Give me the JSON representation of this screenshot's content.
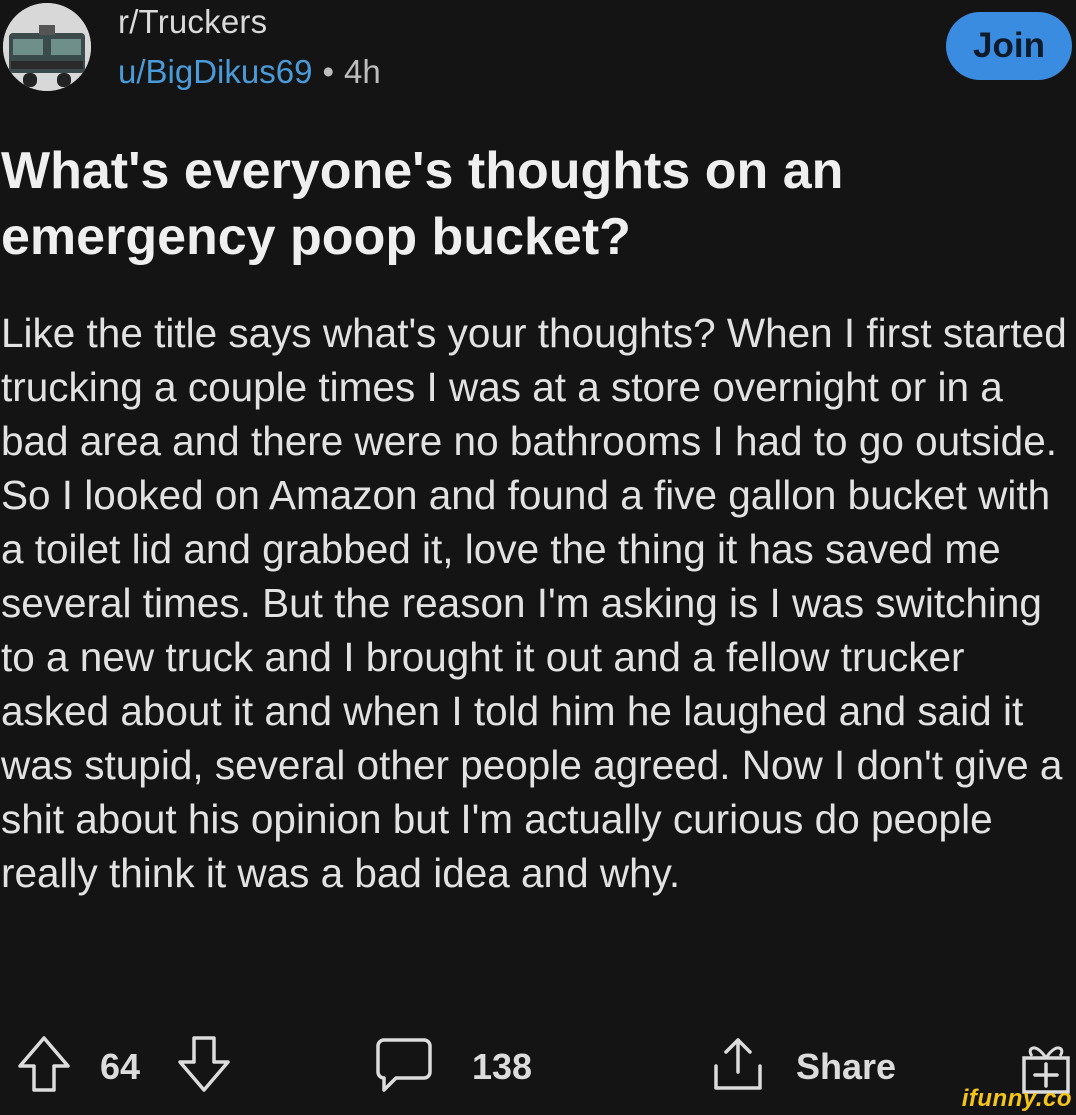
{
  "header": {
    "subreddit": "r/Truckers",
    "username": "u/BigDikus69",
    "separator": "•",
    "age": "4h",
    "join_label": "Join"
  },
  "post": {
    "title": "What's everyone's thoughts on an emergency poop bucket?",
    "body": "Like the title says what's your thoughts? When I first started trucking a couple times I was at a store overnight or in a bad area and there were no bathrooms I had to go outside.  So I looked on Amazon and found a five gallon bucket with a toilet lid and grabbed it, love the thing it has saved me several times. But the reason I'm asking is I was switching to a new truck and I brought it out and a fellow trucker asked about it and when I told him he laughed and said it was stupid, several other people agreed. Now I don't give a shit about his opinion but I'm actually curious do people really think it was a bad idea and why."
  },
  "actions": {
    "upvote_icon": "arrow-up-icon",
    "vote_count": "64",
    "downvote_icon": "arrow-down-icon",
    "comment_icon": "speech-bubble-icon",
    "comment_count": "138",
    "share_icon": "share-icon",
    "share_label": "Share",
    "award_icon": "gift-icon"
  },
  "watermark": "ifunny.co",
  "colors": {
    "background": "#141414",
    "username": "#4a9bd9",
    "join_button": "#3a8ce0",
    "text": "#e2e2e2",
    "watermark": "#f5c518"
  }
}
